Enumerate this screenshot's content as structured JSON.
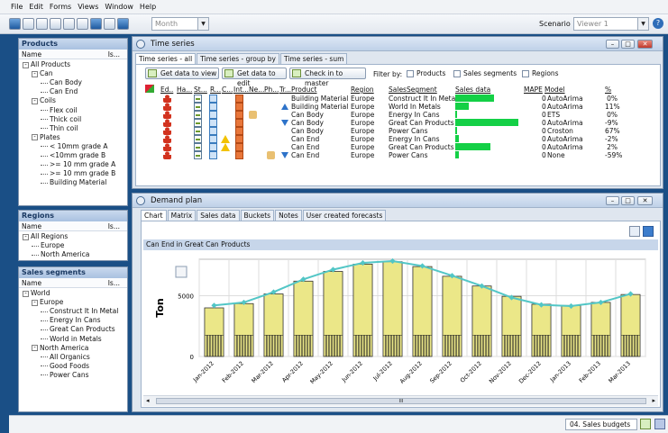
{
  "menu": [
    "File",
    "Edit",
    "Forms",
    "Views",
    "Window",
    "Help"
  ],
  "toolbar": {
    "period_combo": "Month",
    "scenario_label": "Scenario",
    "scenario_value": "Viewer 1"
  },
  "products": {
    "title": "Products",
    "col_name": "Name",
    "col_is": "Is...",
    "items": [
      {
        "label": "All Products",
        "depth": 0,
        "expander": "-"
      },
      {
        "label": "Can",
        "depth": 1,
        "expander": "-"
      },
      {
        "label": "Can Body",
        "depth": 2
      },
      {
        "label": "Can End",
        "depth": 2
      },
      {
        "label": "Coils",
        "depth": 1,
        "expander": "-"
      },
      {
        "label": "Flex coil",
        "depth": 2
      },
      {
        "label": "Thick coil",
        "depth": 2
      },
      {
        "label": "Thin coil",
        "depth": 2
      },
      {
        "label": "Plates",
        "depth": 1,
        "expander": "-"
      },
      {
        "label": "< 10mm grade A",
        "depth": 2
      },
      {
        "label": "<10mm grade B",
        "depth": 2
      },
      {
        "label": ">= 10 mm grade A",
        "depth": 2
      },
      {
        "label": ">= 10 mm grade B",
        "depth": 2
      },
      {
        "label": "Building Material",
        "depth": 2
      }
    ]
  },
  "regions": {
    "title": "Regions",
    "col_name": "Name",
    "col_is": "Is...",
    "items": [
      {
        "label": "All Regions",
        "depth": 0,
        "expander": "-"
      },
      {
        "label": "Europe",
        "depth": 1
      },
      {
        "label": "North America",
        "depth": 1
      }
    ]
  },
  "segments": {
    "title": "Sales segments",
    "col_name": "Name",
    "col_is": "Is...",
    "items": [
      {
        "label": "World",
        "depth": 0,
        "expander": "-"
      },
      {
        "label": "Europe",
        "depth": 1,
        "expander": "-"
      },
      {
        "label": "Construct It In Metal",
        "depth": 2
      },
      {
        "label": "Energy In Cans",
        "depth": 2
      },
      {
        "label": "Great Can Products",
        "depth": 2
      },
      {
        "label": "World in Metals",
        "depth": 2
      },
      {
        "label": "North America",
        "depth": 1,
        "expander": "-"
      },
      {
        "label": "All Organics",
        "depth": 2
      },
      {
        "label": "Good Foods",
        "depth": 2
      },
      {
        "label": "Power Cans",
        "depth": 2
      }
    ]
  },
  "timeseries": {
    "title": "Time series",
    "tabs": [
      "Time series - all",
      "Time series - group by",
      "Time series - sum"
    ],
    "buttons": {
      "get_view": "Get data to view",
      "get_edit": "Get data to edit",
      "check_in": "Check in to master"
    },
    "filter_label": "Filter by:",
    "filters": [
      "Products",
      "Sales segments",
      "Regions"
    ],
    "columns": {
      "ed": "Ed..",
      "ha": "Ha...",
      "st": "St...",
      "r": "R...",
      "c": "C...",
      "int": "Int...",
      "ne": "Ne...",
      "ph": "Ph...",
      "tr": "Tr...",
      "product": "Product",
      "region": "Region",
      "segment": "SalesSegment",
      "sales": "Sales data",
      "mape": "MAPE",
      "model": "Model",
      "pct": "%"
    },
    "rows": [
      {
        "product": "Building Material",
        "region": "Europe",
        "segment": "Construct It In Metal",
        "sales": 0.62,
        "mape": "0",
        "model": "AutoArima",
        "pct": "0%",
        "warn": false,
        "note": false,
        "trend": ""
      },
      {
        "product": "Building Material",
        "region": "Europe",
        "segment": "World In Metals",
        "sales": 0.22,
        "mape": "0",
        "model": "AutoArima",
        "pct": "11%",
        "warn": false,
        "note": false,
        "trend": "up"
      },
      {
        "product": "Can Body",
        "region": "Europe",
        "segment": "Energy In Cans",
        "sales": 0.0,
        "mape": "0",
        "model": "ETS",
        "pct": "0%",
        "warn": false,
        "note": true,
        "trend": ""
      },
      {
        "product": "Can Body",
        "region": "Europe",
        "segment": "Great Can Products",
        "sales": 1.0,
        "mape": "0",
        "model": "AutoArima",
        "pct": "-9%",
        "warn": false,
        "note": false,
        "trend": "down"
      },
      {
        "product": "Can Body",
        "region": "Europe",
        "segment": "Power Cans",
        "sales": 0.0,
        "mape": "0",
        "model": "Croston",
        "pct": "67%",
        "warn": false,
        "note": false,
        "trend": ""
      },
      {
        "product": "Can End",
        "region": "Europe",
        "segment": "Energy In Cans",
        "sales": 0.06,
        "mape": "0",
        "model": "AutoArima",
        "pct": "-2%",
        "warn": true,
        "note": false,
        "trend": ""
      },
      {
        "product": "Can End",
        "region": "Europe",
        "segment": "Great Can Products",
        "sales": 0.55,
        "mape": "0",
        "model": "AutoArima",
        "pct": "2%",
        "warn": true,
        "note": false,
        "trend": ""
      },
      {
        "product": "Can End",
        "region": "Europe",
        "segment": "Power Cans",
        "sales": 0.05,
        "mape": "0",
        "model": "None",
        "pct": "-59%",
        "warn": false,
        "note": true,
        "trend": "down"
      }
    ]
  },
  "demandplan": {
    "title": "Demand plan",
    "tabs": [
      "Chart",
      "Matrix",
      "Sales data",
      "Buckets",
      "Notes",
      "User created forecasts"
    ],
    "scroll_mid": "III"
  },
  "chart_data": {
    "type": "bar",
    "title": "Can End in Great Can Products",
    "ylabel": "Ton",
    "xlabel": "",
    "ylim": [
      0,
      8000
    ],
    "yticks": [
      0,
      5000
    ],
    "categories": [
      "Jan-2012",
      "Feb-2012",
      "Mar-2012",
      "Apr-2012",
      "May-2012",
      "Jun-2012",
      "Jul-2012",
      "Aug-2012",
      "Sep-2012",
      "Oct-2012",
      "Nov-2012",
      "Dec-2012",
      "Jan-2013",
      "Feb-2013",
      "Mar-2013"
    ],
    "series": [
      {
        "values": [
          4000,
          4350,
          5150,
          6200,
          7000,
          7600,
          7800,
          7400,
          6600,
          5800,
          4950,
          4300,
          4200,
          4450,
          5100
        ]
      },
      {
        "values": [
          4200,
          4450,
          5300,
          6350,
          7150,
          7700,
          7850,
          7450,
          6650,
          5800,
          4850,
          4250,
          4150,
          4450,
          5150
        ]
      }
    ],
    "colors": {
      "bar": "#ebe788",
      "bar_border": "#333",
      "line": "#52c6c6",
      "plot_bg": "#ffffff"
    },
    "grid": true,
    "legend": "none"
  },
  "status": {
    "text": "04. Sales budgets"
  }
}
